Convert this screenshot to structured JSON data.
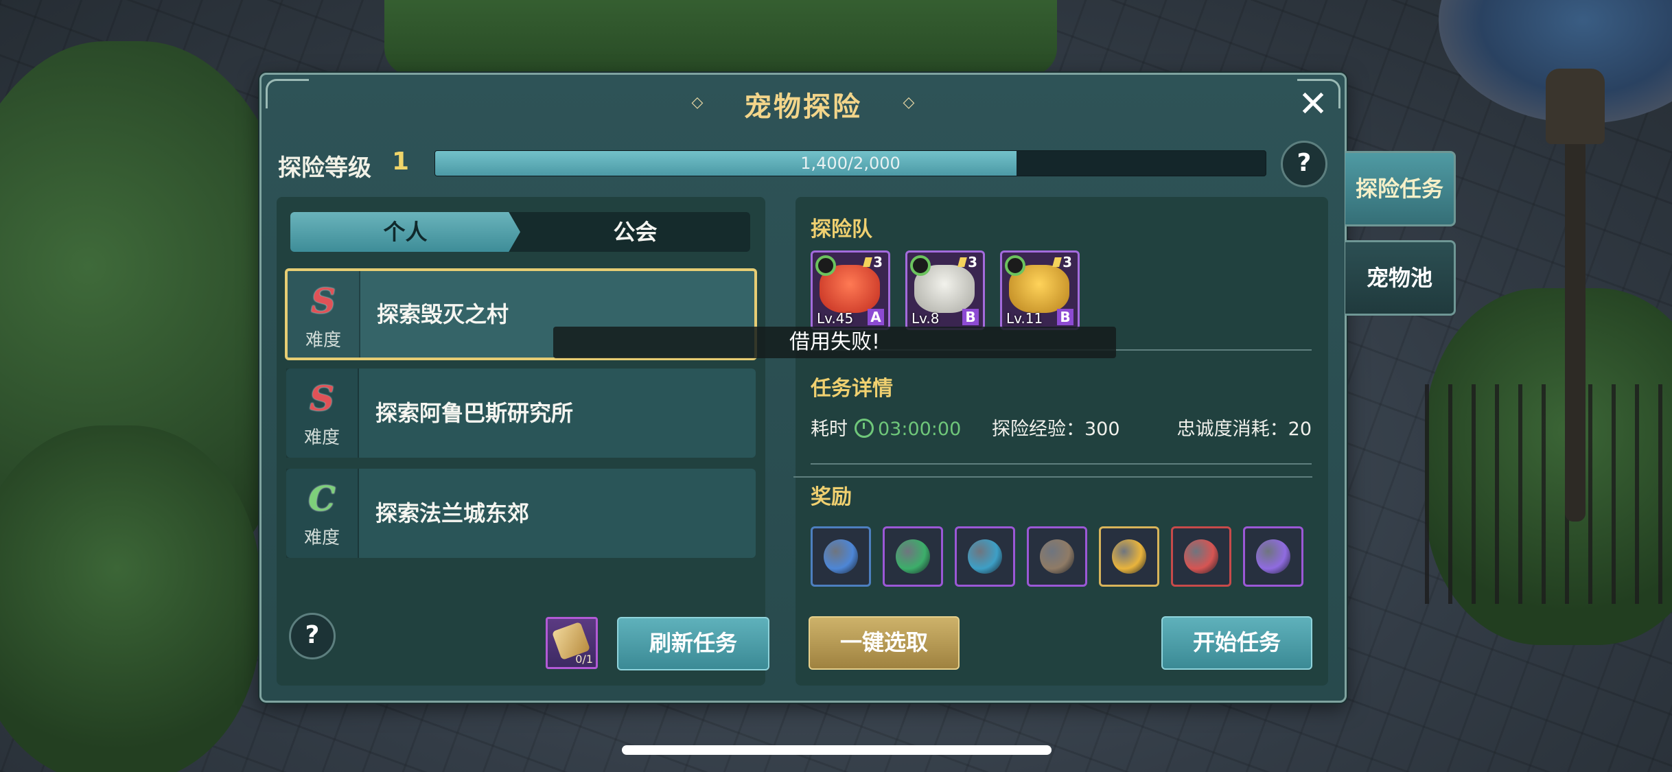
{
  "panel": {
    "title": "宠物探险",
    "close_icon": "close-icon"
  },
  "level": {
    "label": "探险等级",
    "value": "1",
    "progress_text": "1,400/2,000",
    "progress_fraction": 0.7
  },
  "tabs": [
    "个人",
    "公会"
  ],
  "tasks": [
    {
      "grade": "S",
      "difficulty_label": "难度",
      "name": "探索毁灭之村",
      "selected": true
    },
    {
      "grade": "S",
      "difficulty_label": "难度",
      "name": "探索阿鲁巴斯研究所",
      "selected": false
    },
    {
      "grade": "C",
      "difficulty_label": "难度",
      "name": "探索法兰城东郊",
      "selected": false
    }
  ],
  "left_footer": {
    "help": "?",
    "scroll_count": "0/1",
    "refresh_label": "刷新任务"
  },
  "team": {
    "title": "探险队",
    "pets": [
      {
        "level": "Lv.45",
        "rank": "A",
        "stars": "3",
        "color": "#d9432e"
      },
      {
        "level": "Lv.8",
        "rank": "B",
        "stars": "3",
        "color": "#d8d8d0"
      },
      {
        "level": "Lv.11",
        "rank": "B",
        "stars": "3",
        "color": "#e2b23a"
      }
    ]
  },
  "toast": "借用失败!",
  "details": {
    "title": "任务详情",
    "time_label": "耗时",
    "time_value": "03:00:00",
    "exp_text": "探险经验：300",
    "loyalty_text": "忠诚度消耗：20"
  },
  "rewards": {
    "title": "奖励",
    "items": [
      {
        "icon": "exp-icon",
        "color": "#4d86d6",
        "border": "#4d7fbf"
      },
      {
        "icon": "green-orb-icon",
        "color": "#3cae6a",
        "border": "#9b58d6"
      },
      {
        "icon": "blue-orb-icon",
        "color": "#3d9fc6",
        "border": "#9b58d6"
      },
      {
        "icon": "mystery-box-icon",
        "color": "#8f7b66",
        "border": "#9b58d6"
      },
      {
        "icon": "gold-ticket-icon",
        "color": "#e9b43c",
        "border": "#d9b45a"
      },
      {
        "icon": "red-ticket-icon",
        "color": "#d65553",
        "border": "#c84a4a"
      },
      {
        "icon": "purple-ticket-icon",
        "color": "#8f6be0",
        "border": "#9b58d6"
      }
    ]
  },
  "buttons": {
    "select_all": "一键选取",
    "start": "开始任务",
    "help_top": "?"
  },
  "side_tabs": [
    "探险任务",
    "宠物池"
  ]
}
